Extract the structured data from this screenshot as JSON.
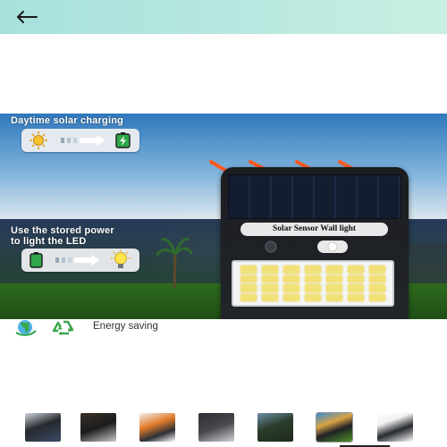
{
  "header": {
    "back_icon": "arrow-left-icon",
    "accent": "#a6e1dc"
  },
  "product_image": {
    "daytime_label": "Daytime solar charging",
    "stored_power_label": "Use the stored power\nto light the LED",
    "lamp_label": "Solar Sensor Wall light",
    "day_icons": [
      "sun-icon",
      "charging-battery-icon"
    ],
    "night_icons": [
      "full-battery-icon",
      "light-bulb-icon"
    ]
  },
  "features": {
    "icons": [
      "globe-icon",
      "recycle-icon"
    ],
    "energy_label": "Energy saving"
  },
  "thumbnails": {
    "count": 7,
    "active_index": 5
  },
  "colors": {
    "accent_green": "#2ea84a",
    "arrow_orange": "#ff5a1f"
  }
}
